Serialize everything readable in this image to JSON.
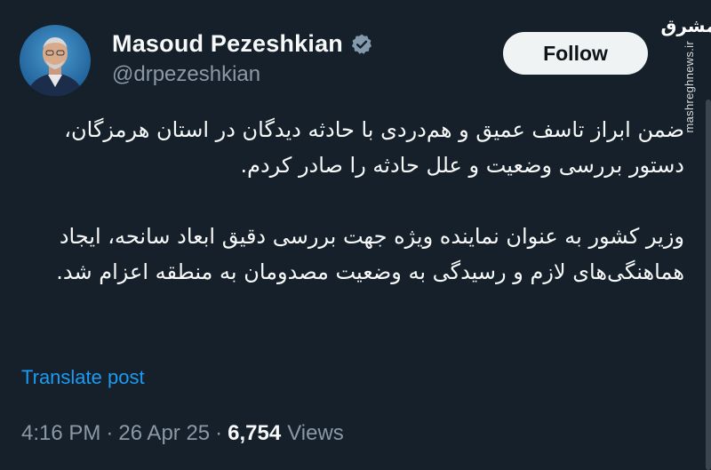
{
  "author": {
    "display_name": "Masoud Pezeshkian",
    "handle": "@drpezeshkian",
    "verified_icon": "verified-badge-icon"
  },
  "follow_button": {
    "label": "Follow"
  },
  "tweet": {
    "paragraphs": [
      "ضمن ابراز تاسف عمیق و هم‌دردی با حادثه دیدگان در استان هرمزگان، دستور بررسی وضعیت و علل حادثه را صادر کردم.",
      "وزیر کشور به عنوان نماینده ویژه جهت بررسی دقیق ابعاد سانحه، ایجاد هماهنگی‌های لازم و رسیدگی به وضعیت مصدومان به منطقه اعزام شد."
    ]
  },
  "translate": {
    "label": "Translate post"
  },
  "meta": {
    "time": "4:16 PM",
    "separator": "·",
    "date": "26 Apr 25",
    "views_count": "6,754",
    "views_label": "Views"
  },
  "watermark": {
    "logo": "مشرق",
    "url": "mashreghnews.ir"
  },
  "colors": {
    "background": "#15202b",
    "text": "#f7f9f9",
    "secondary": "#8b98a5",
    "link": "#1d9bf0",
    "verified": "#829aab",
    "follow_bg": "#eff3f4"
  }
}
